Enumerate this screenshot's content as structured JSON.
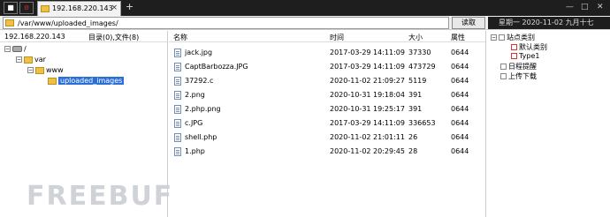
{
  "titlebar": {
    "stop_icon": "■",
    "gear_icon": "⚙",
    "tab_label": "192.168.220.143",
    "tab_close": "×",
    "new_tab": "+",
    "minimize": "—",
    "maximize": "□",
    "close": "✕"
  },
  "toolbar": {
    "path_value": "/var/www/uploaded_images/",
    "read_button": "读取",
    "datetime": "星期一  2020-11-02  九月十七"
  },
  "left_pane": {
    "host": "192.168.220.143",
    "counts": "目录(0),文件(8)",
    "tree": [
      {
        "label": "/",
        "expander": "−"
      },
      {
        "label": "var",
        "expander": "−"
      },
      {
        "label": "www",
        "expander": "−"
      },
      {
        "label": "uploaded_images",
        "expander": ""
      }
    ]
  },
  "file_pane": {
    "headers": {
      "name": "名称",
      "time": "时间",
      "size": "大小",
      "attr": "属性"
    },
    "files": [
      {
        "name": "jack.jpg",
        "time": "2017-03-29 14:11:09",
        "size": "37330",
        "attr": "0644"
      },
      {
        "name": "CaptBarbozza.JPG",
        "time": "2017-03-29 14:11:09",
        "size": "473729",
        "attr": "0644"
      },
      {
        "name": "37292.c",
        "time": "2020-11-02 21:09:27",
        "size": "5119",
        "attr": "0644"
      },
      {
        "name": "2.png",
        "time": "2020-10-31 19:18:04",
        "size": "391",
        "attr": "0644"
      },
      {
        "name": "2.php.png",
        "time": "2020-10-31 19:25:17",
        "size": "391",
        "attr": "0644"
      },
      {
        "name": "c.JPG",
        "time": "2017-03-29 14:11:09",
        "size": "336653",
        "attr": "0644"
      },
      {
        "name": "shell.php",
        "time": "2020-11-02 21:01:11",
        "size": "26",
        "attr": "0644"
      },
      {
        "name": "1.php",
        "time": "2020-11-02 20:29:45",
        "size": "28",
        "attr": "0644"
      }
    ]
  },
  "right_pane": {
    "items": [
      {
        "label": "站点类别",
        "expander": "−"
      },
      {
        "label": "默认类别",
        "expander": ""
      },
      {
        "label": "Type1",
        "expander": ""
      },
      {
        "label": "日程提醒",
        "expander": ""
      },
      {
        "label": "上传下载",
        "expander": ""
      }
    ]
  },
  "watermark": "FREEBUF"
}
